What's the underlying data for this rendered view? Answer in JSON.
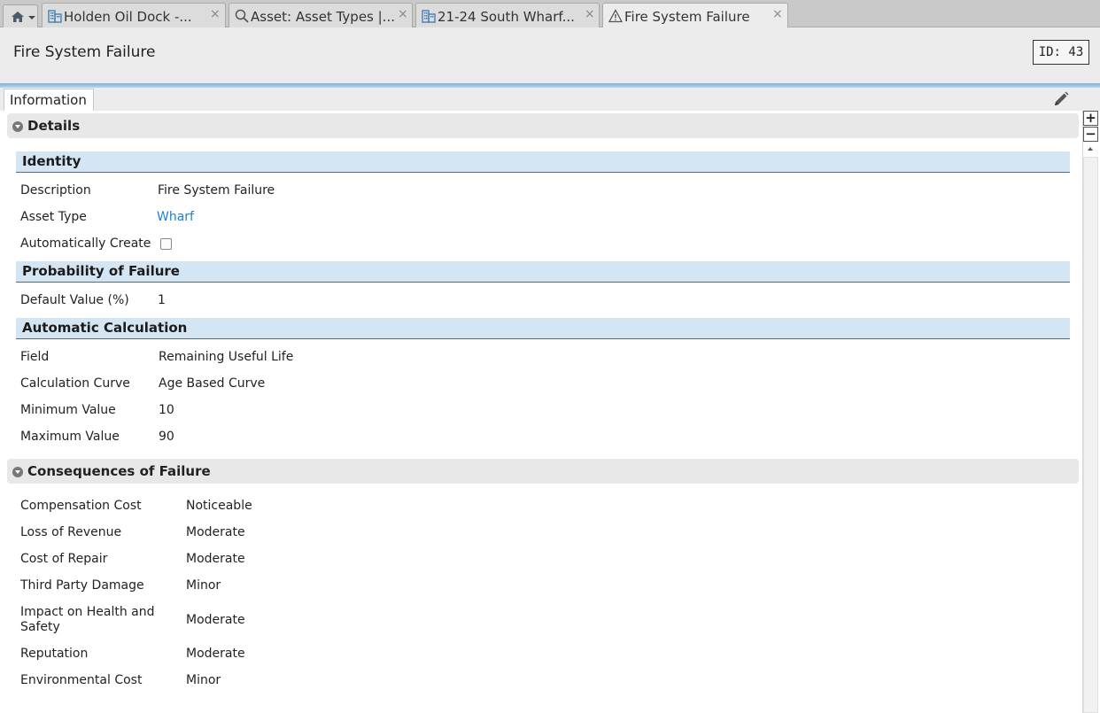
{
  "tabs": [
    {
      "label": "Holden Oil Dock -...",
      "icon": "building-icon"
    },
    {
      "label": "Asset: Asset Types |...",
      "icon": "search-icon"
    },
    {
      "label": "21-24 South Wharf...",
      "icon": "building-icon"
    },
    {
      "label": "Fire System Failure",
      "icon": "warning-icon",
      "active": true
    }
  ],
  "tab_close": "×",
  "header": {
    "title": "Fire System Failure",
    "id_label": "ID: 43"
  },
  "subtab": {
    "label": "Information"
  },
  "details": {
    "title": "Details",
    "identity": {
      "title": "Identity",
      "description_label": "Description",
      "description_value": "Fire System Failure",
      "asset_type_label": "Asset Type",
      "asset_type_value": "Wharf",
      "auto_create_label": "Automatically Create",
      "auto_create_checked": false
    },
    "probability": {
      "title": "Probability of Failure",
      "default_label": "Default Value (%)",
      "default_value": "1"
    },
    "automatic": {
      "title": "Automatic Calculation",
      "field_label": "Field",
      "field_value": "Remaining Useful Life",
      "curve_label": "Calculation Curve",
      "curve_value": "Age Based Curve",
      "min_label": "Minimum Value",
      "min_value": "10",
      "max_label": "Maximum Value",
      "max_value": "90"
    }
  },
  "consequences": {
    "title": "Consequences of Failure",
    "rows": [
      {
        "label": "Compensation Cost",
        "value": "Noticeable"
      },
      {
        "label": "Loss of Revenue",
        "value": "Moderate"
      },
      {
        "label": "Cost of Repair",
        "value": "Moderate"
      },
      {
        "label": "Third Party Damage",
        "value": "Minor"
      },
      {
        "label": "Impact on Health and Safety",
        "value": "Moderate"
      },
      {
        "label": "Reputation",
        "value": "Moderate"
      },
      {
        "label": "Environmental Cost",
        "value": "Minor"
      }
    ]
  },
  "zoom": {
    "in": "+",
    "out": "−"
  },
  "colors": {
    "link": "#1e7fd0",
    "group_header": "#d4e6f3",
    "accent_rule": "#7fb1dc"
  }
}
